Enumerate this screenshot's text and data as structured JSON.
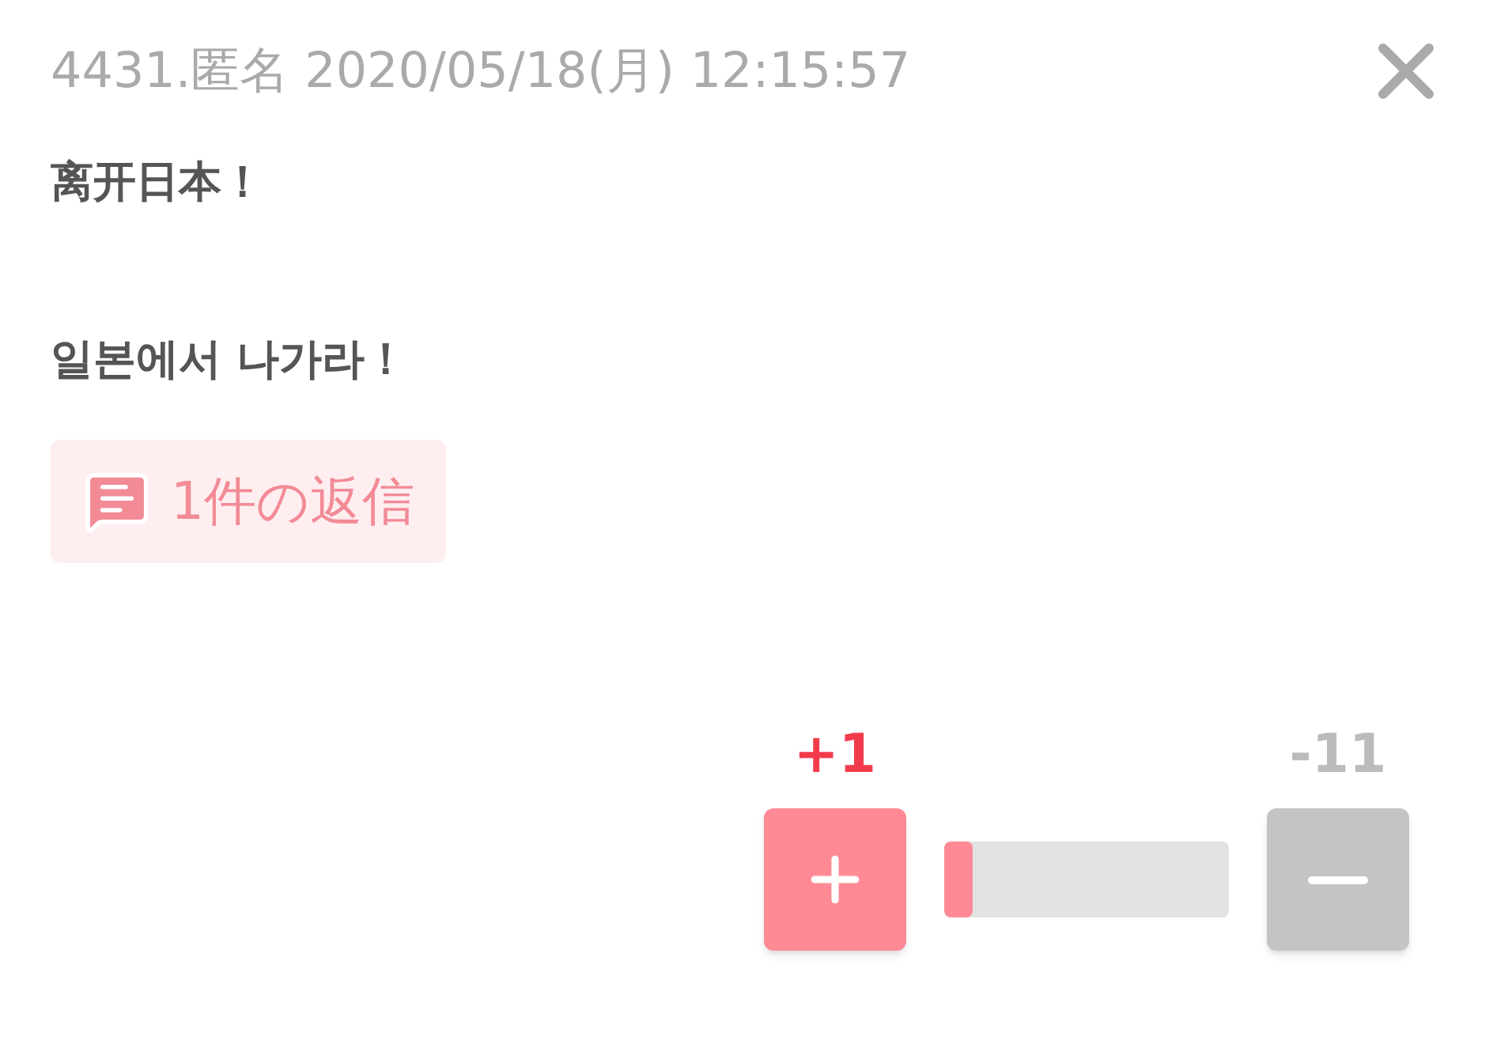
{
  "post": {
    "header": "4431.匿名 2020/05/18(月) 12:15:57",
    "body": [
      "离开日本！",
      "일본에서 나가라！"
    ],
    "replies": "1件の返信"
  },
  "votes": {
    "up": "+1",
    "down": "-11",
    "level": 0.1
  }
}
